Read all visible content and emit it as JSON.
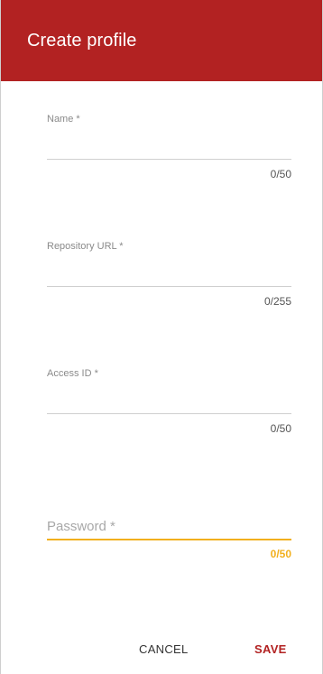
{
  "header": {
    "title": "Create profile",
    "color": "#b22222"
  },
  "fields": [
    {
      "label": "Name *",
      "value": "",
      "counter": "0/50"
    },
    {
      "label": "Repository URL *",
      "value": "",
      "counter": "0/255"
    },
    {
      "label": "Access ID *",
      "value": "",
      "counter": "0/50"
    },
    {
      "label": "Password *",
      "value": "",
      "counter": "0/50",
      "focused": true,
      "accent": "#f2b01e"
    }
  ],
  "actions": {
    "cancel_label": "CANCEL",
    "save_label": "SAVE"
  }
}
